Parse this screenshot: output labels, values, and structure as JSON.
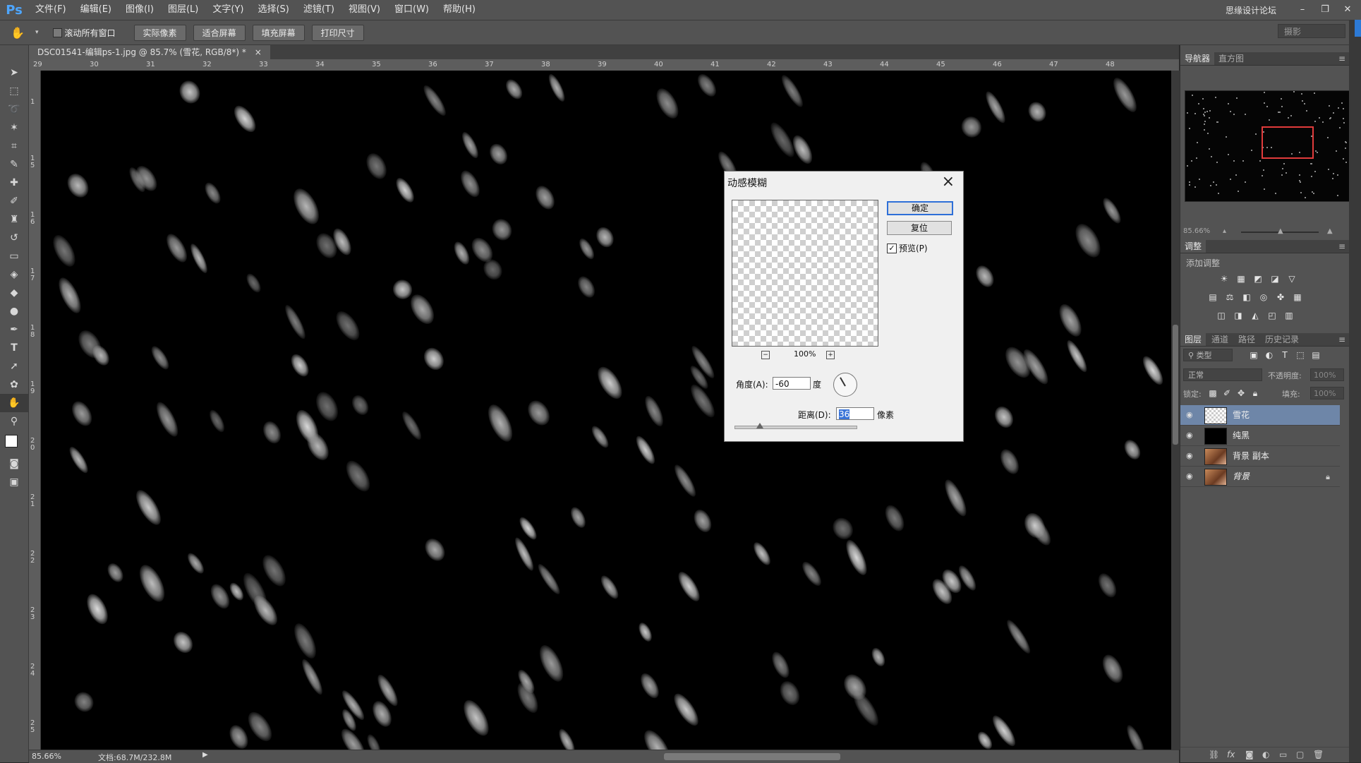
{
  "app": {
    "logo": "Ps",
    "menu": [
      "文件(F)",
      "编辑(E)",
      "图像(I)",
      "图层(L)",
      "文字(Y)",
      "选择(S)",
      "滤镜(T)",
      "视图(V)",
      "窗口(W)",
      "帮助(H)"
    ],
    "watermark": "思缘设计论坛"
  },
  "options": {
    "scroll_all": "滚动所有窗口",
    "buttons": [
      "实际像素",
      "适合屏幕",
      "填充屏幕",
      "打印尺寸"
    ],
    "workspace": "摄影"
  },
  "document": {
    "tab": "DSC01541-编辑ps-1.jpg @ 85.7% (雪花, RGB/8*) *",
    "ruler_h": [
      "29",
      "30",
      "31",
      "32",
      "33",
      "34",
      "35",
      "36",
      "37",
      "38",
      "39",
      "40",
      "41",
      "42",
      "43",
      "44",
      "45",
      "46",
      "47",
      "48"
    ],
    "ruler_v": [
      "1",
      "1\n5",
      "1\n6",
      "1\n7",
      "1\n8",
      "1\n9",
      "2\n0",
      "2\n1",
      "2\n2",
      "2\n3",
      "2\n4",
      "2\n5"
    ],
    "status_zoom": "85.66%",
    "status_doc": "文档:68.7M/232.8M"
  },
  "navigator": {
    "tabs": [
      "导航器",
      "直方图"
    ],
    "zoom": "85.66%"
  },
  "adjustments": {
    "tab": "调整",
    "title": "添加调整"
  },
  "layers": {
    "tabs": [
      "图层",
      "通道",
      "路径",
      "历史记录"
    ],
    "filter_kind": "类型",
    "blend_mode": "正常",
    "opacity_label": "不透明度:",
    "opacity_value": "100%",
    "lock_label": "锁定:",
    "fill_label": "填充:",
    "fill_value": "100%",
    "items": [
      {
        "name": "雪花",
        "selected": true
      },
      {
        "name": "纯黑",
        "selected": false
      },
      {
        "name": "背景 副本",
        "selected": false
      },
      {
        "name": "背景",
        "selected": false,
        "locked": true
      }
    ]
  },
  "dialog": {
    "title": "动感模糊",
    "ok": "确定",
    "reset": "复位",
    "preview_label": "预览(P)",
    "preview_checked": true,
    "zoom": "100%",
    "angle_label": "角度(A):",
    "angle_value": "-60",
    "angle_unit": "度",
    "distance_label": "距离(D):",
    "distance_value": "36",
    "distance_unit": "像素"
  }
}
